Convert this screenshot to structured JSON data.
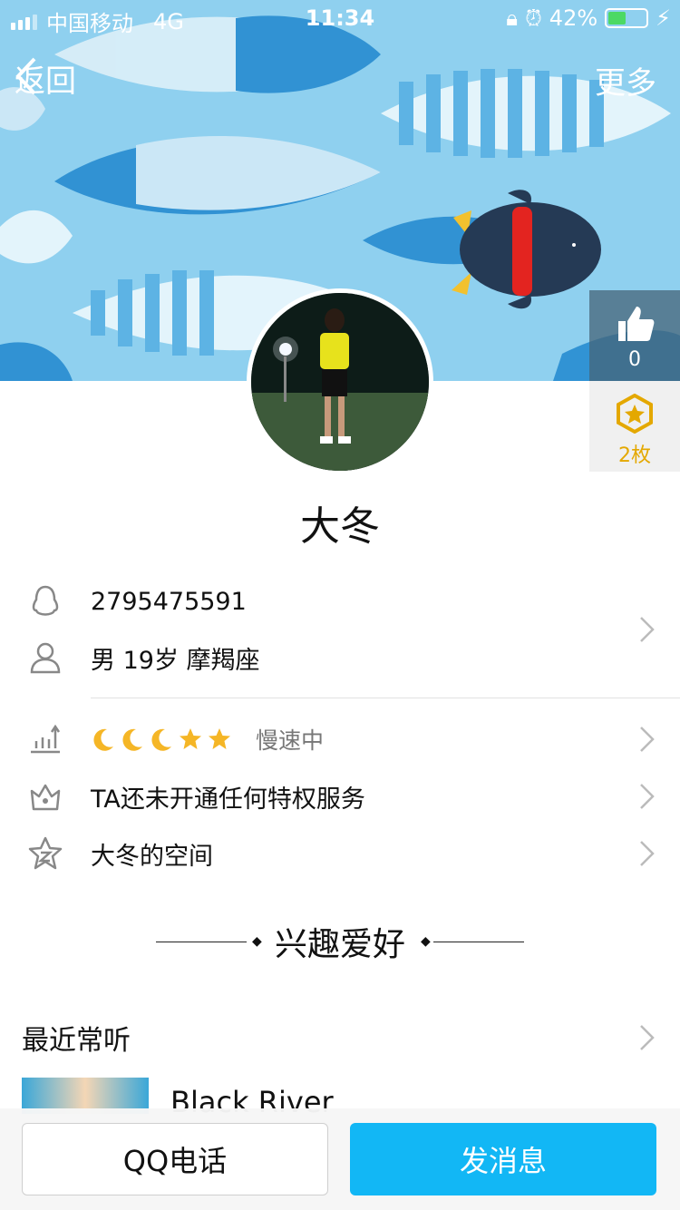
{
  "status_bar": {
    "carrier": "中国移动",
    "network": "4G",
    "time": "11:34",
    "battery": "42%"
  },
  "nav": {
    "back_label": "返回",
    "more_label": "更多"
  },
  "side": {
    "like_count": "0",
    "medal_count": "2枚"
  },
  "profile": {
    "name": "大冬",
    "qq_number": "2795475591",
    "basic_info": "男 19岁 摩羯座",
    "level_status": "慢速中",
    "privilege": "TA还未开通任何特权服务",
    "space": "大冬的空间"
  },
  "interests": {
    "title": "兴趣爱好",
    "recent_label": "最近常听",
    "song_title": "Black River"
  },
  "actions": {
    "call_label": "QQ电话",
    "message_label": "发消息"
  },
  "colors": {
    "accent": "#12b7f5",
    "cover_bg": "#8fd0ef",
    "medal": "#e4a800"
  }
}
